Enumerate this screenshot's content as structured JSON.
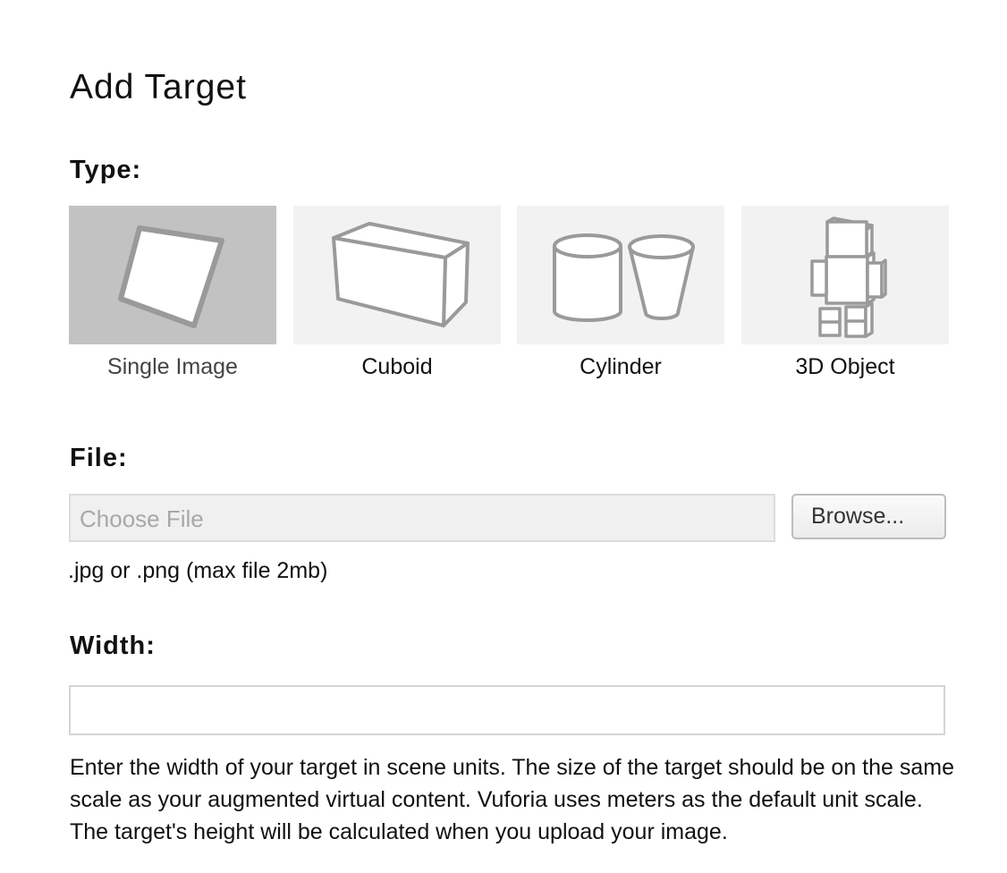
{
  "page": {
    "title": "Add Target"
  },
  "type_section": {
    "label": "Type:",
    "options": [
      {
        "label": "Single Image",
        "icon": "single-image-icon",
        "selected": true
      },
      {
        "label": "Cuboid",
        "icon": "cuboid-icon",
        "selected": false
      },
      {
        "label": "Cylinder",
        "icon": "cylinder-icon",
        "selected": false
      },
      {
        "label": "3D Object",
        "icon": "3d-object-icon",
        "selected": false
      }
    ]
  },
  "file_section": {
    "label": "File:",
    "placeholder": "Choose File",
    "browse_label": "Browse...",
    "hint": ".jpg or .png (max file 2mb)"
  },
  "width_section": {
    "label": "Width:",
    "value": "",
    "help": "Enter the width of your target in scene units. The size of the target should be on the same scale as your augmented virtual content. Vuforia uses meters as the default unit scale. The target's height will be calculated when you upload your image."
  },
  "colors": {
    "selected_tile": "#c2c2c2",
    "tile": "#f2f2f2",
    "icon_stroke": "#9a9a9a",
    "text": "#111111"
  }
}
